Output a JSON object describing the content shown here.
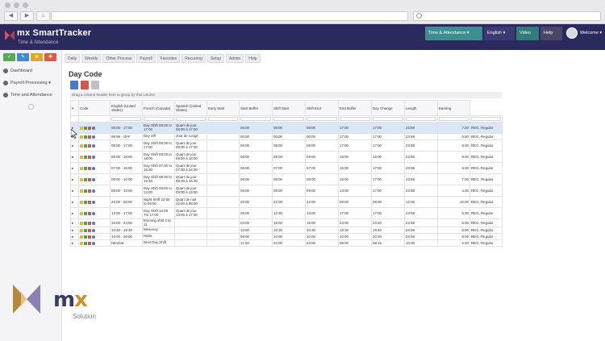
{
  "browser": {
    "back_icon": "back-arrow-icon",
    "forward_icon": "forward-arrow-icon",
    "home_icon": "home-icon"
  },
  "app": {
    "brand": "mx SmartTracker",
    "subtitle": "Time & Attendance",
    "module_button": "Time & Attendance ▾",
    "language_button": "English ▾",
    "video_button": "Video",
    "help_button": "Help",
    "user_label": "Welcome ▾"
  },
  "sidebar": {
    "items": [
      {
        "label": "Dashboard"
      },
      {
        "label": "Payroll Processing"
      },
      {
        "label": "Time and Attendance"
      }
    ]
  },
  "menu": [
    "Daily",
    "Weekly",
    "Other Process",
    "Payroll",
    "Favorites",
    "Recurring",
    "Setup",
    "Admin",
    "Help"
  ],
  "page": {
    "title": "Day Code",
    "group_hint": "Drag a column header here to group by that column"
  },
  "table": {
    "columns": [
      "#",
      "Code",
      "English (United States)",
      "French (Canada)",
      "Spanish (United States)",
      "Early Start",
      "Start Buffer",
      "Shift Start",
      "Shift End",
      "End Buffer",
      "Day Change",
      "Length",
      "Earning"
    ],
    "rows": [
      [
        "08:00 - 17:00",
        "Day Shift 08:00 to 17:00",
        "Quart de jour 08:00 à 17:00",
        "",
        "06:00",
        "08:00",
        "08:00",
        "17:00",
        "17:00",
        "23:59",
        "7.00",
        "REG, Regular"
      ],
      [
        "99:99 - OFF",
        "Day Off",
        "Jour de congé",
        "",
        "00:00",
        "00:00",
        "00:00",
        "17:00",
        "17:00",
        "23:59",
        "0.00",
        "REG, Regular"
      ],
      [
        "08:00 - 17:00",
        "Day Shift 08:00 to 17:00",
        "Quart de jour 08:00 à 17:00",
        "",
        "06:00",
        "08:00",
        "08:00",
        "17:00",
        "17:00",
        "23:59",
        "8.00",
        "REG, Regular"
      ],
      [
        "09:00 - 18:00",
        "Day Shift 08:00 to 18:00",
        "Quart de jour 09:00 à 18:00",
        "",
        "06:00",
        "09:00",
        "09:00",
        "18:00",
        "18:00",
        "23:59",
        "8.00",
        "REG, Regular"
      ],
      [
        "07:00 - 16:00",
        "Day Shift 07:30 to 16:30",
        "Quart de jour 07:30 à 16:30",
        "",
        "06:00",
        "07:00",
        "07:00",
        "16:00",
        "17:00",
        "23:59",
        "8.00",
        "REG, Regular"
      ],
      [
        "08:00 - 16:00",
        "Day Shift 08:30 to 16:30",
        "Quart de jour 08:30 à 16:30",
        "",
        "06:00",
        "08:00",
        "08:00",
        "16:00",
        "17:00",
        "23:59",
        "7.00",
        "REG, Regular"
      ],
      [
        "09:00 - 13:00",
        "Day Shift 09:00 to 13:00",
        "Quart de jour 09:00 à 13:00",
        "",
        "06:00",
        "09:00",
        "09:00",
        "13:00",
        "17:00",
        "23:59",
        "4.00",
        "REG, Regular"
      ],
      [
        "22:00 - 08:00",
        "Night Shift 22:00 to 08:00",
        "Quart de nuit 22:00 à 08:00",
        "",
        "20:00",
        "22:00",
        "22:00",
        "08:00",
        "09:00",
        "12:00",
        "10.00",
        "REG, Regular"
      ],
      [
        "13:00 - 17:00",
        "Day Shift 13:00 TO 17:00",
        "Quart de jour 13:00 à 17:00",
        "",
        "06:00",
        "12:30",
        "13:00",
        "17:00",
        "17:00",
        "23:59",
        "5.00",
        "REG, Regular"
      ],
      [
        "16:00 - 23:00",
        "Evening shift 4 to 11",
        "",
        "",
        "04:00",
        "15:00",
        "16:00",
        "23:00",
        "23:40",
        "23:59",
        "6.00",
        "REG, Regular"
      ],
      [
        "10:30 - 19:30",
        "Mesenoy",
        "",
        "",
        "10:00",
        "10:30",
        "10:30",
        "19:30",
        "19:40",
        "23:59",
        "9.00",
        "REG, Regular"
      ],
      [
        "10:00 - 20:00",
        "Haha",
        "",
        "",
        "09:00",
        "10:00",
        "10:00",
        "20:00",
        "20:30",
        "23:59",
        "8.00",
        "REG, Regular"
      ],
      [
        "NEvDat",
        "Next Day Shift",
        "",
        "",
        "11:00",
        "22:00",
        "23:00",
        "08:00",
        "08:15",
        "10:00",
        "5.00",
        "REG, Regular"
      ]
    ]
  },
  "footer_logo": {
    "mark": "mx",
    "accent": "x",
    "tagline": "Solution"
  },
  "colors": {
    "appbar": "#2b2a5e",
    "accent_teal": "#3d8f8f",
    "selected_row": "#dbe7f7",
    "logo_gold": "#c9922e"
  }
}
